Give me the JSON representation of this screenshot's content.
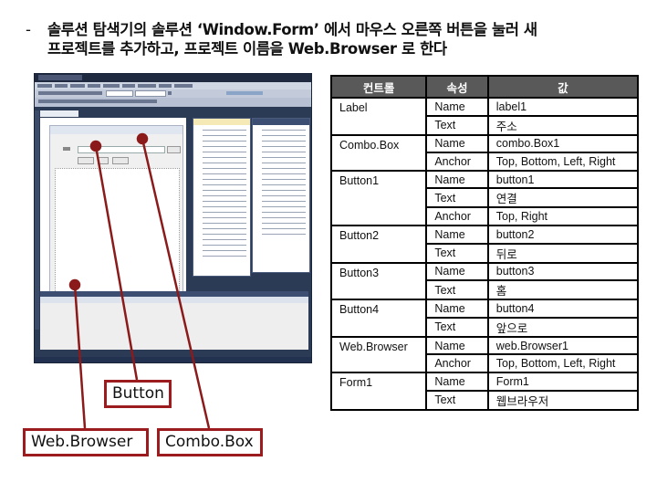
{
  "instruction": {
    "bullet": "-",
    "line1": "솔루션 탐색기의 솔루션 ‘Window.Form’ 에서 마우스 오른쪽 버튼을 눌러 새",
    "line2": "프로젝트를 추가하고, 프로젝트 이름을 Web.Browser 로 한다"
  },
  "callouts": {
    "button": "Button",
    "webbrowser": "Web.Browser",
    "combobox": "Combo.Box"
  },
  "colors": {
    "callout_border": "#9b1b1e",
    "table_header_bg": "#595959",
    "vs_frame": "#2b3a55"
  },
  "table": {
    "headers": [
      "컨트롤",
      "속성",
      "값"
    ],
    "groups": [
      {
        "control": "Label",
        "rows": [
          {
            "prop": "Name",
            "value": "label1"
          },
          {
            "prop": "Text",
            "value": "주소"
          }
        ]
      },
      {
        "control": "Combo.Box",
        "rows": [
          {
            "prop": "Name",
            "value": "combo.Box1"
          },
          {
            "prop": "Anchor",
            "value": "Top, Bottom, Left, Right"
          }
        ]
      },
      {
        "control": "Button1",
        "rows": [
          {
            "prop": "Name",
            "value": "button1"
          },
          {
            "prop": "Text",
            "value": "연결"
          },
          {
            "prop": "Anchor",
            "value": "Top, Right"
          }
        ]
      },
      {
        "control": "Button2",
        "rows": [
          {
            "prop": "Name",
            "value": "button2"
          },
          {
            "prop": "Text",
            "value": "뒤로"
          }
        ]
      },
      {
        "control": "Button3",
        "rows": [
          {
            "prop": "Name",
            "value": "button3"
          },
          {
            "prop": "Text",
            "value": "홈"
          }
        ]
      },
      {
        "control": "Button4",
        "rows": [
          {
            "prop": "Name",
            "value": "button4"
          },
          {
            "prop": "Text",
            "value": "앞으로"
          }
        ]
      },
      {
        "control": "Web.Browser",
        "rows": [
          {
            "prop": "Name",
            "value": "web.Browser1"
          },
          {
            "prop": "Anchor",
            "value": "Top, Bottom, Left, Right"
          }
        ]
      },
      {
        "control": "Form1",
        "rows": [
          {
            "prop": "Name",
            "value": "Form1"
          },
          {
            "prop": "Text",
            "value": "웹브라우저"
          }
        ]
      }
    ]
  }
}
